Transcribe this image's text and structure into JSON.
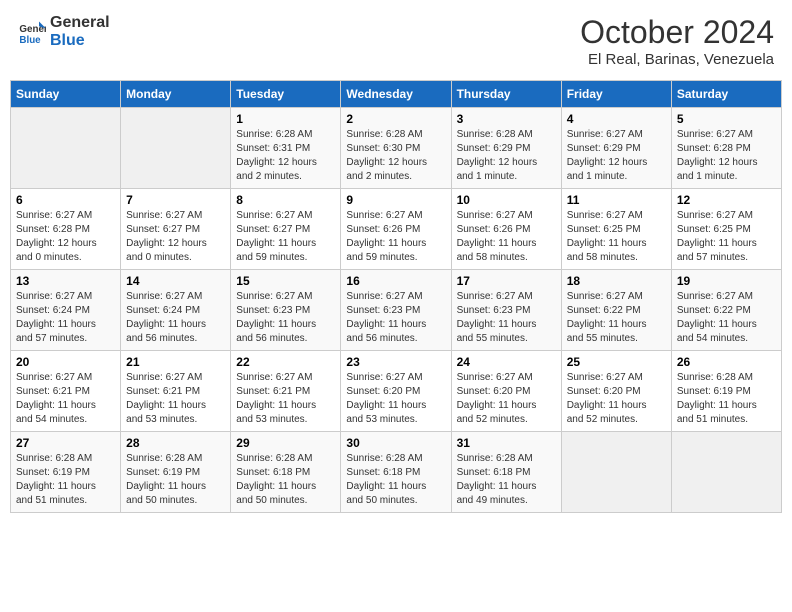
{
  "header": {
    "logo_line1": "General",
    "logo_line2": "Blue",
    "month": "October 2024",
    "location": "El Real, Barinas, Venezuela"
  },
  "days_of_week": [
    "Sunday",
    "Monday",
    "Tuesday",
    "Wednesday",
    "Thursday",
    "Friday",
    "Saturday"
  ],
  "weeks": [
    [
      {
        "day": "",
        "sunrise": "",
        "sunset": "",
        "daylight": ""
      },
      {
        "day": "",
        "sunrise": "",
        "sunset": "",
        "daylight": ""
      },
      {
        "day": "1",
        "sunrise": "Sunrise: 6:28 AM",
        "sunset": "Sunset: 6:31 PM",
        "daylight": "Daylight: 12 hours and 2 minutes."
      },
      {
        "day": "2",
        "sunrise": "Sunrise: 6:28 AM",
        "sunset": "Sunset: 6:30 PM",
        "daylight": "Daylight: 12 hours and 2 minutes."
      },
      {
        "day": "3",
        "sunrise": "Sunrise: 6:28 AM",
        "sunset": "Sunset: 6:29 PM",
        "daylight": "Daylight: 12 hours and 1 minute."
      },
      {
        "day": "4",
        "sunrise": "Sunrise: 6:27 AM",
        "sunset": "Sunset: 6:29 PM",
        "daylight": "Daylight: 12 hours and 1 minute."
      },
      {
        "day": "5",
        "sunrise": "Sunrise: 6:27 AM",
        "sunset": "Sunset: 6:28 PM",
        "daylight": "Daylight: 12 hours and 1 minute."
      }
    ],
    [
      {
        "day": "6",
        "sunrise": "Sunrise: 6:27 AM",
        "sunset": "Sunset: 6:28 PM",
        "daylight": "Daylight: 12 hours and 0 minutes."
      },
      {
        "day": "7",
        "sunrise": "Sunrise: 6:27 AM",
        "sunset": "Sunset: 6:27 PM",
        "daylight": "Daylight: 12 hours and 0 minutes."
      },
      {
        "day": "8",
        "sunrise": "Sunrise: 6:27 AM",
        "sunset": "Sunset: 6:27 PM",
        "daylight": "Daylight: 11 hours and 59 minutes."
      },
      {
        "day": "9",
        "sunrise": "Sunrise: 6:27 AM",
        "sunset": "Sunset: 6:26 PM",
        "daylight": "Daylight: 11 hours and 59 minutes."
      },
      {
        "day": "10",
        "sunrise": "Sunrise: 6:27 AM",
        "sunset": "Sunset: 6:26 PM",
        "daylight": "Daylight: 11 hours and 58 minutes."
      },
      {
        "day": "11",
        "sunrise": "Sunrise: 6:27 AM",
        "sunset": "Sunset: 6:25 PM",
        "daylight": "Daylight: 11 hours and 58 minutes."
      },
      {
        "day": "12",
        "sunrise": "Sunrise: 6:27 AM",
        "sunset": "Sunset: 6:25 PM",
        "daylight": "Daylight: 11 hours and 57 minutes."
      }
    ],
    [
      {
        "day": "13",
        "sunrise": "Sunrise: 6:27 AM",
        "sunset": "Sunset: 6:24 PM",
        "daylight": "Daylight: 11 hours and 57 minutes."
      },
      {
        "day": "14",
        "sunrise": "Sunrise: 6:27 AM",
        "sunset": "Sunset: 6:24 PM",
        "daylight": "Daylight: 11 hours and 56 minutes."
      },
      {
        "day": "15",
        "sunrise": "Sunrise: 6:27 AM",
        "sunset": "Sunset: 6:23 PM",
        "daylight": "Daylight: 11 hours and 56 minutes."
      },
      {
        "day": "16",
        "sunrise": "Sunrise: 6:27 AM",
        "sunset": "Sunset: 6:23 PM",
        "daylight": "Daylight: 11 hours and 56 minutes."
      },
      {
        "day": "17",
        "sunrise": "Sunrise: 6:27 AM",
        "sunset": "Sunset: 6:23 PM",
        "daylight": "Daylight: 11 hours and 55 minutes."
      },
      {
        "day": "18",
        "sunrise": "Sunrise: 6:27 AM",
        "sunset": "Sunset: 6:22 PM",
        "daylight": "Daylight: 11 hours and 55 minutes."
      },
      {
        "day": "19",
        "sunrise": "Sunrise: 6:27 AM",
        "sunset": "Sunset: 6:22 PM",
        "daylight": "Daylight: 11 hours and 54 minutes."
      }
    ],
    [
      {
        "day": "20",
        "sunrise": "Sunrise: 6:27 AM",
        "sunset": "Sunset: 6:21 PM",
        "daylight": "Daylight: 11 hours and 54 minutes."
      },
      {
        "day": "21",
        "sunrise": "Sunrise: 6:27 AM",
        "sunset": "Sunset: 6:21 PM",
        "daylight": "Daylight: 11 hours and 53 minutes."
      },
      {
        "day": "22",
        "sunrise": "Sunrise: 6:27 AM",
        "sunset": "Sunset: 6:21 PM",
        "daylight": "Daylight: 11 hours and 53 minutes."
      },
      {
        "day": "23",
        "sunrise": "Sunrise: 6:27 AM",
        "sunset": "Sunset: 6:20 PM",
        "daylight": "Daylight: 11 hours and 53 minutes."
      },
      {
        "day": "24",
        "sunrise": "Sunrise: 6:27 AM",
        "sunset": "Sunset: 6:20 PM",
        "daylight": "Daylight: 11 hours and 52 minutes."
      },
      {
        "day": "25",
        "sunrise": "Sunrise: 6:27 AM",
        "sunset": "Sunset: 6:20 PM",
        "daylight": "Daylight: 11 hours and 52 minutes."
      },
      {
        "day": "26",
        "sunrise": "Sunrise: 6:28 AM",
        "sunset": "Sunset: 6:19 PM",
        "daylight": "Daylight: 11 hours and 51 minutes."
      }
    ],
    [
      {
        "day": "27",
        "sunrise": "Sunrise: 6:28 AM",
        "sunset": "Sunset: 6:19 PM",
        "daylight": "Daylight: 11 hours and 51 minutes."
      },
      {
        "day": "28",
        "sunrise": "Sunrise: 6:28 AM",
        "sunset": "Sunset: 6:19 PM",
        "daylight": "Daylight: 11 hours and 50 minutes."
      },
      {
        "day": "29",
        "sunrise": "Sunrise: 6:28 AM",
        "sunset": "Sunset: 6:18 PM",
        "daylight": "Daylight: 11 hours and 50 minutes."
      },
      {
        "day": "30",
        "sunrise": "Sunrise: 6:28 AM",
        "sunset": "Sunset: 6:18 PM",
        "daylight": "Daylight: 11 hours and 50 minutes."
      },
      {
        "day": "31",
        "sunrise": "Sunrise: 6:28 AM",
        "sunset": "Sunset: 6:18 PM",
        "daylight": "Daylight: 11 hours and 49 minutes."
      },
      {
        "day": "",
        "sunrise": "",
        "sunset": "",
        "daylight": ""
      },
      {
        "day": "",
        "sunrise": "",
        "sunset": "",
        "daylight": ""
      }
    ]
  ]
}
